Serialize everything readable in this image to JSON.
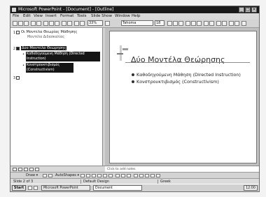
{
  "window": {
    "title": "Microsoft PowerPoint - [Document] - [Outline]",
    "min_glyph": "_",
    "max_glyph": "□",
    "close_glyph": "×"
  },
  "menubar": {
    "items": [
      "File",
      "Edit",
      "View",
      "Insert",
      "Format",
      "Tools",
      "Slide Show",
      "Window",
      "Help"
    ]
  },
  "toolbar": {
    "zoom": "33%",
    "font": "Tahoma",
    "size": "18"
  },
  "outline": {
    "slide1": {
      "num": "1",
      "title": "Οι Μοντέλα Θεωρίας Μάθησης",
      "subtitle": "Μοντέλα Διδασκαλίας"
    },
    "slide2": {
      "num": "2",
      "title": "Δύο Μοντέλα Θεώρησης",
      "bullets": [
        "Καθοδηγούμενη Μάθηση (Directed Instruction)",
        "Κονστρουκτιβισμός (Constructivism)"
      ]
    },
    "slide3": {
      "num": "3"
    }
  },
  "slide": {
    "title": "Δύο Μοντέλα Θεώρησης",
    "bullets": [
      "Καθοδηγούμενη Μάθηση (Directed Instruction)",
      "Κονστρουκτιβισμός (Constructivism)"
    ]
  },
  "notes": {
    "placeholder": "Click to add notes"
  },
  "drawbar": {
    "draw_label": "Draw ▾",
    "autoshapes_label": "AutoShapes ▾"
  },
  "statusbar": {
    "slide": "Slide 2 of 3",
    "template": "Default Design",
    "language": "Greek"
  },
  "taskbar": {
    "start": "Start",
    "tasks": [
      "Microsoft PowerPoint",
      "Document"
    ],
    "clock": "12:00"
  }
}
